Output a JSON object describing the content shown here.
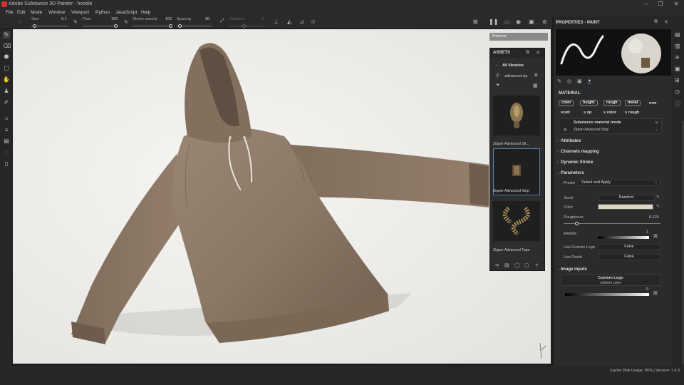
{
  "window": {
    "title": "Adobe Substance 3D Painter - hoodie",
    "minimize": "–",
    "restore": "❐",
    "close": "✕"
  },
  "menu": [
    "File",
    "Edit",
    "Mode",
    "Window",
    "Viewport",
    "Python",
    "JavaScript",
    "Help"
  ],
  "tool_options": {
    "size_label": "Size",
    "size_value": "0.1",
    "flow_label": "Flow",
    "flow_value": "100",
    "stroke_opacity_label": "Stroke opacity",
    "stroke_opacity_value": "100",
    "spacing_label": "Spacing",
    "spacing_value": "30",
    "distance_label": "Distance",
    "distance_value": "0"
  },
  "viewport": {
    "material_crumb": "Material",
    "fabric_color": "#8a7765"
  },
  "assets": {
    "title": "ASSETS",
    "library": "All libraries",
    "search_value": "advanced zip",
    "items": [
      {
        "label": "Zipper Advanced Sli..."
      },
      {
        "label": "Zipper Advanced Stop"
      },
      {
        "label": "Zipper Advanced Tape"
      }
    ]
  },
  "properties": {
    "title": "PROPERTIES - PAINT",
    "material_section": "MATERIAL",
    "channels_row1": [
      "color",
      "height",
      "rough",
      "metal",
      "nrm"
    ],
    "channels_row2": [
      "scatt",
      "s op",
      "s color",
      "s rough"
    ],
    "mode_title": "Substance material mode",
    "mode_value": "Zipper Advanced Stop",
    "sections": [
      "Attributes",
      "Channels mapping",
      "Dynamic Stroke",
      "Parameters"
    ],
    "preset_label": "Preset",
    "preset_value": "Select and Apply",
    "seed_label": "Seed",
    "seed_value": "Random",
    "color_label": "Color",
    "color_swatch": "#ddd6c2",
    "roughness_label": "Roughness",
    "roughness_value": "0.125",
    "metallic_label": "Metallic",
    "metallic_value": "1",
    "custom_logo_label": "Use Custom Logo",
    "custom_logo_value": "False",
    "finish_label": "Use Finish",
    "finish_value": "False",
    "image_inputs_section": "Image inputs",
    "image_input_title": "Custom Logo",
    "image_input_sub": "uniform color",
    "image_input_value": "0"
  },
  "status": {
    "text": "Cache Disk Usage:   85%  |  Version: 7.4.0"
  }
}
